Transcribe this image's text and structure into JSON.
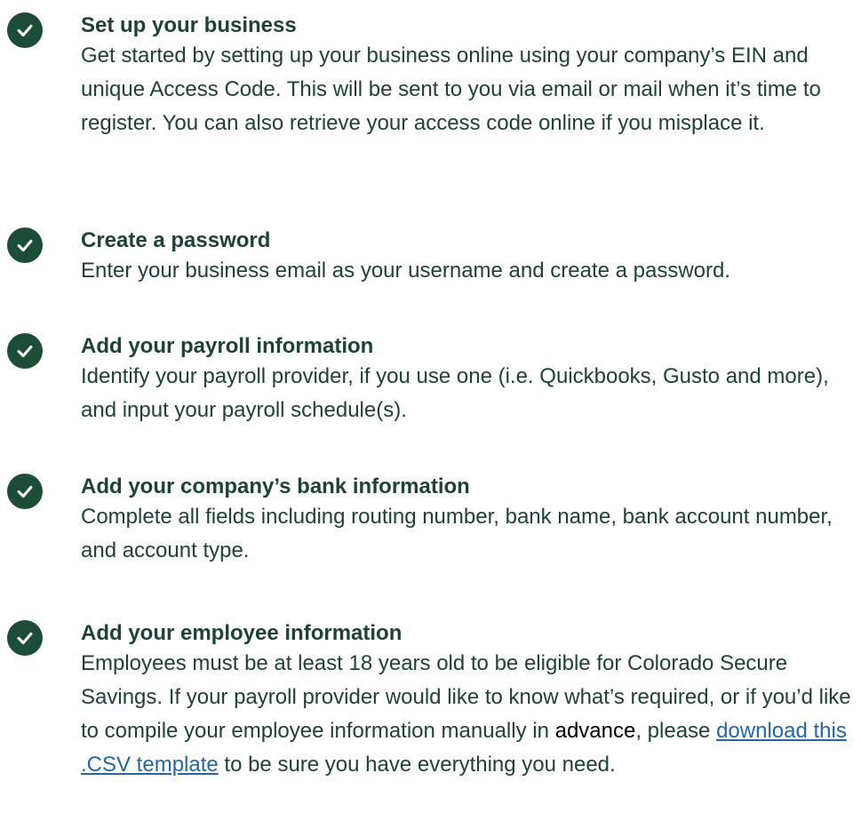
{
  "colors": {
    "check_circle": "#1c4d36",
    "text": "#1e4238",
    "link": "#2566a8"
  },
  "steps": [
    {
      "icon": "check-circle-icon",
      "title": "Set up your business",
      "description": "Get started by setting up your business online using your company’s EIN and unique Access Code. This will be sent to you via email or mail when it’s time to register. You can also retrieve your access code online if you misplace it."
    },
    {
      "icon": "check-circle-icon",
      "title": "Create a password",
      "description": "Enter your business email as your username and create a password."
    },
    {
      "icon": "check-circle-icon",
      "title": "Add your payroll information",
      "description": "Identify your payroll provider, if you use one (i.e. Quickbooks, Gusto and more), and input your payroll schedule(s)."
    },
    {
      "icon": "check-circle-icon",
      "title": "Add your company’s bank information",
      "description": "Complete all fields including routing number, bank name, bank account number, and account type."
    },
    {
      "icon": "check-circle-icon",
      "title": "Add your employee information",
      "description_part1": "Employees must be at least 18 years old to be eligible for Colorado Secure Savings. If your payroll provider would like to know what’s required, or if you’d like to compile your employee information manually in ",
      "description_dark": "advance",
      "description_part2": ", please ",
      "link_text": "download this .CSV template",
      "description_part3": " to be sure you have everything you need."
    }
  ]
}
